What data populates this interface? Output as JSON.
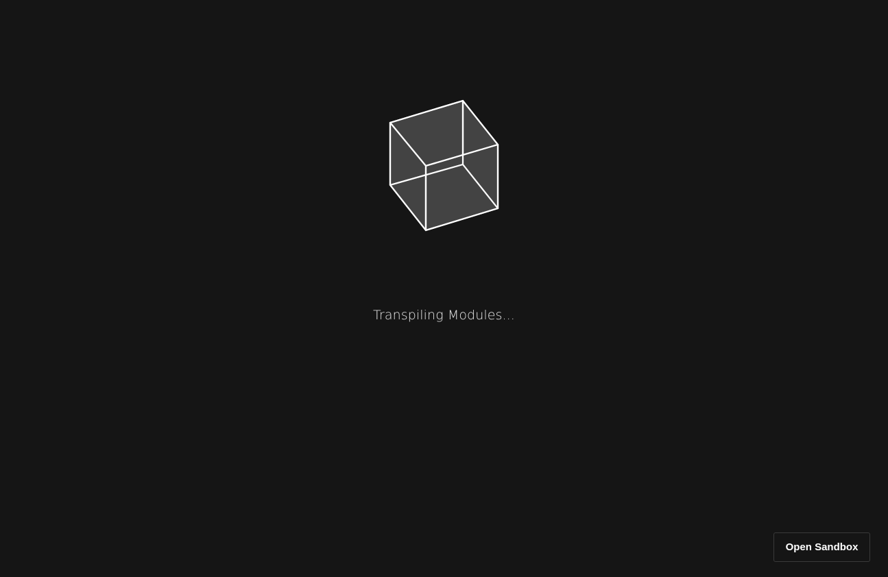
{
  "loader": {
    "icon": "wireframe-cube-icon",
    "status_text": "Transpiling Modules..."
  },
  "actions": {
    "open_sandbox_label": "Open Sandbox"
  },
  "colors": {
    "background": "#151515",
    "cube_face": "#444444",
    "cube_edge": "#ffffff",
    "text": "#e6e6e6",
    "button_border": "#3a3a3a"
  }
}
